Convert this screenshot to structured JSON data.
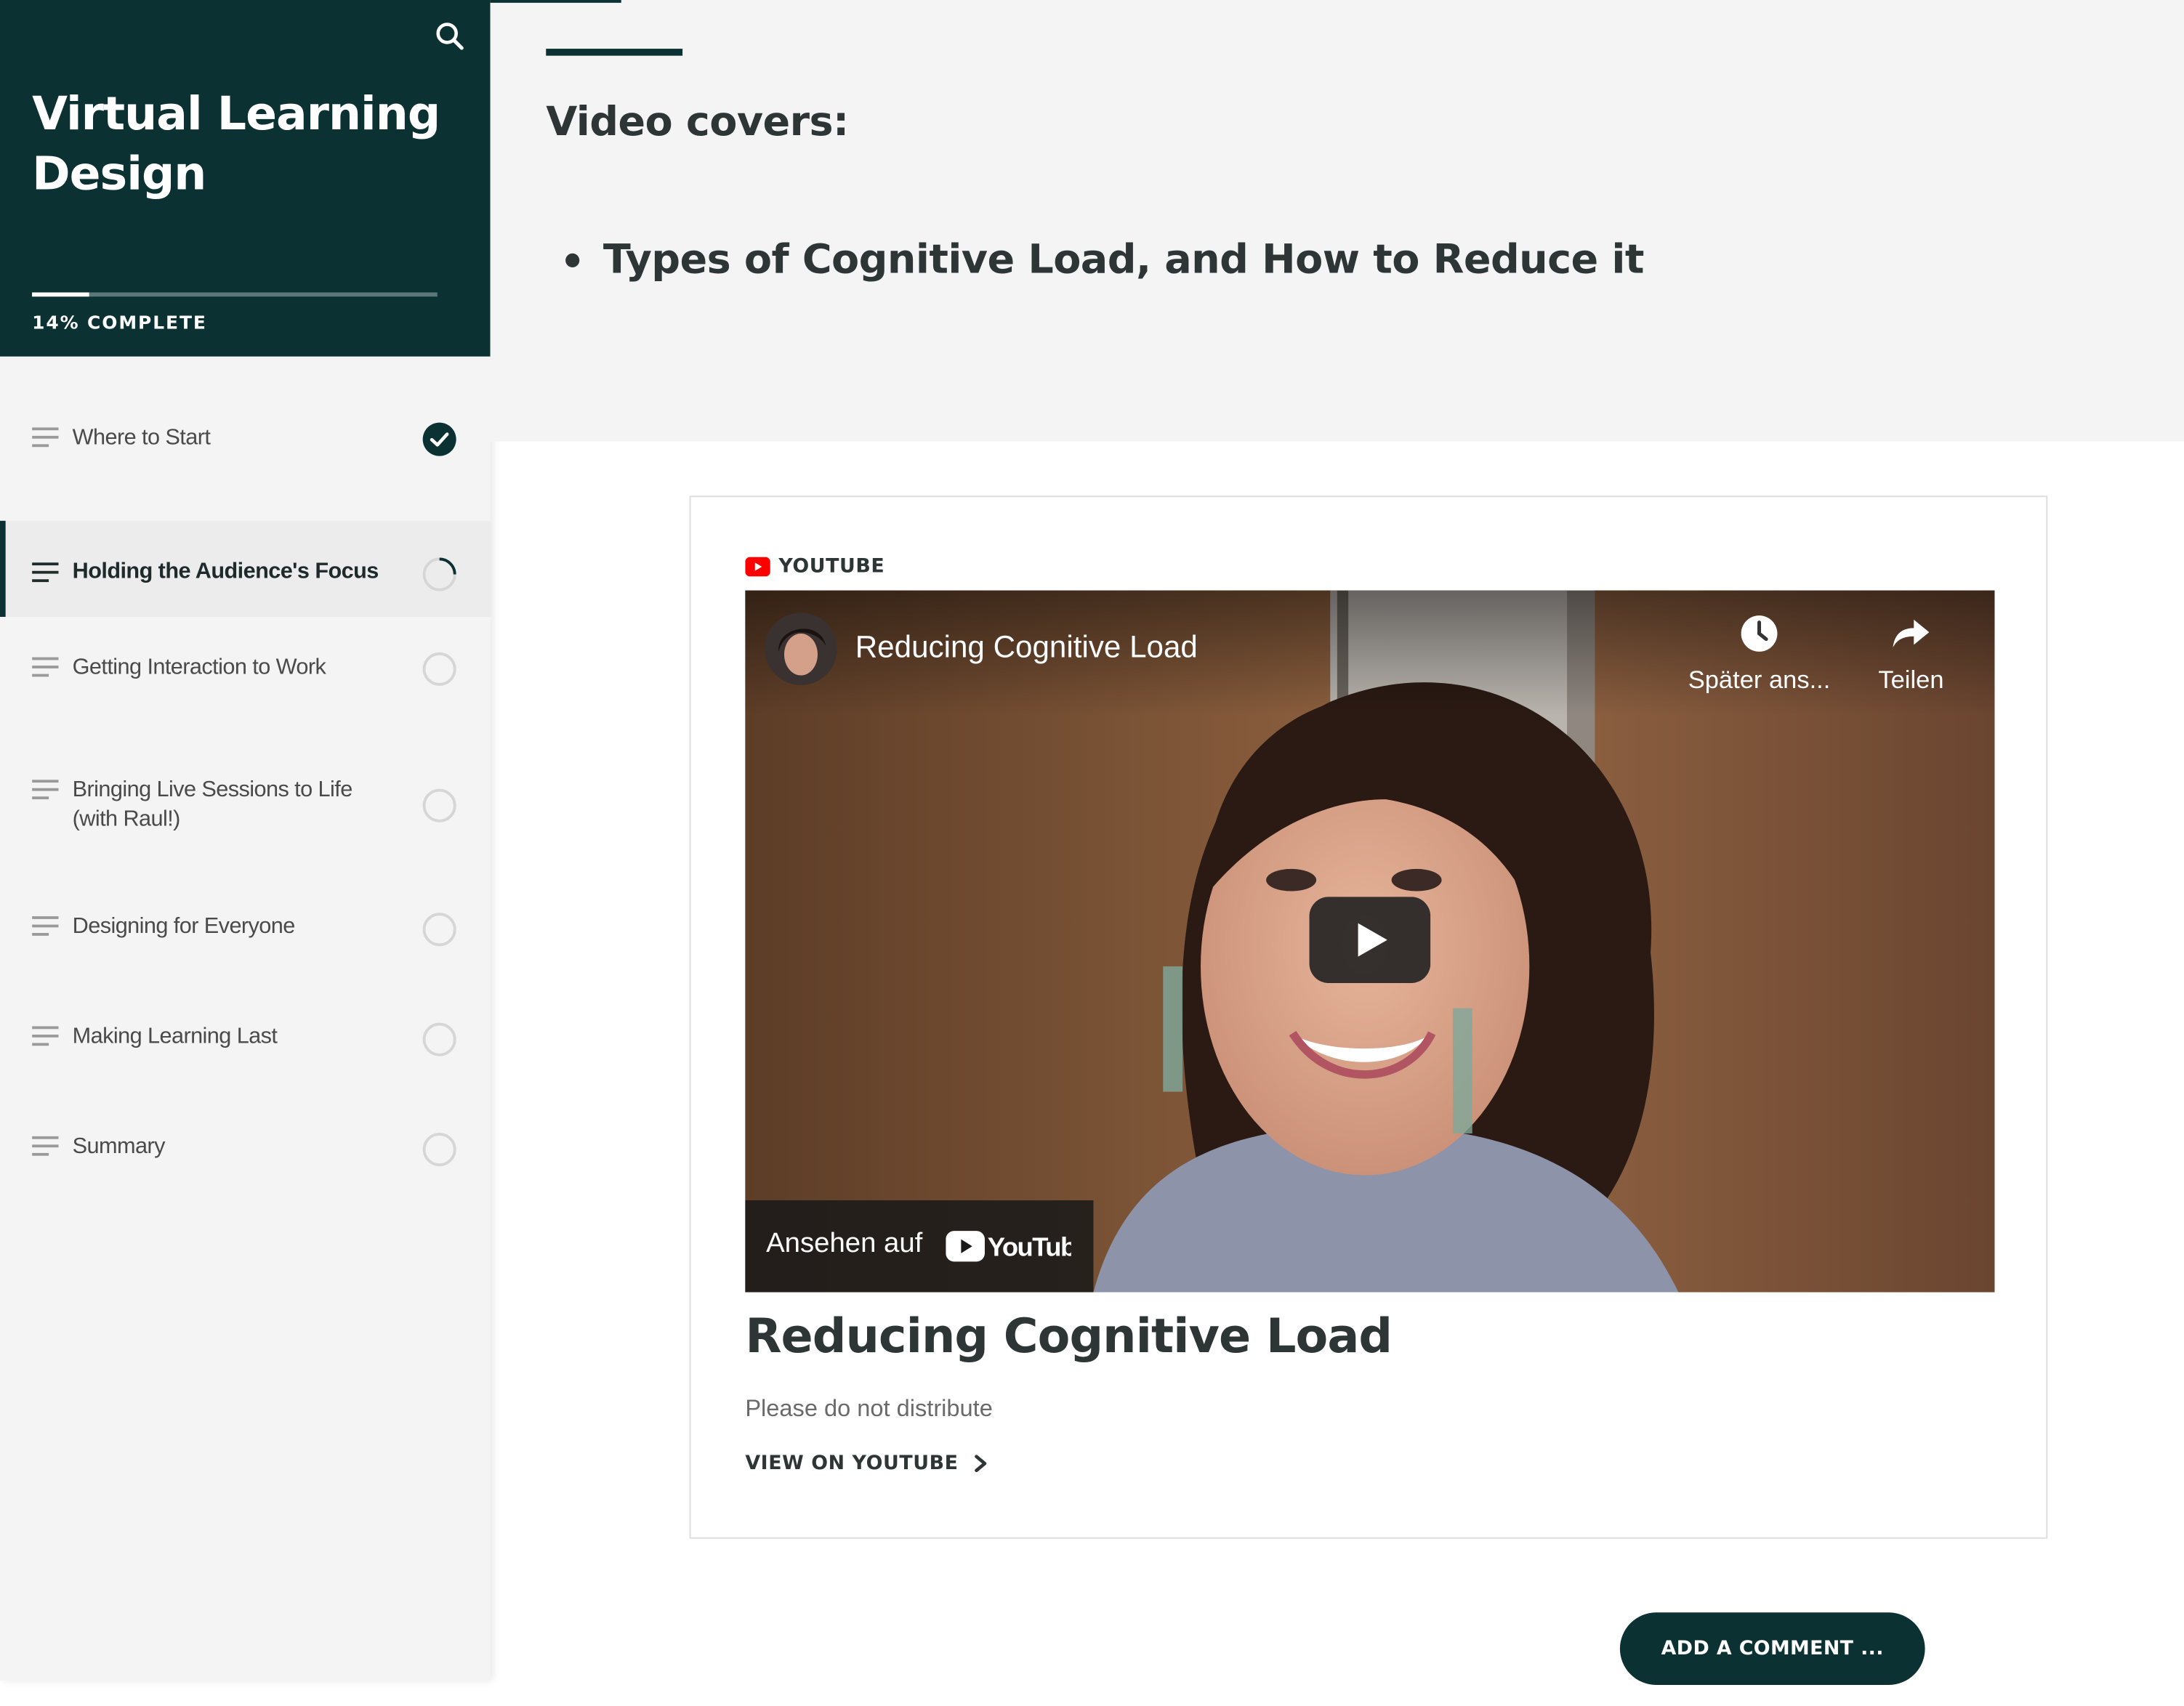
{
  "sidebar": {
    "search_icon": "search-icon",
    "course_title": "Virtual Learning Design",
    "progress": {
      "percent": 14,
      "label": "14% COMPLETE"
    },
    "lessons": [
      {
        "label": "Where to Start",
        "status": "complete"
      },
      {
        "label": "Holding the Audience's Focus",
        "status": "in-progress",
        "active": true
      },
      {
        "label": "Getting Interaction to Work",
        "status": "not-started"
      },
      {
        "label": "Bringing Live Sessions to Life (with Raul!)",
        "status": "not-started"
      },
      {
        "label": "Designing for Everyone",
        "status": "not-started"
      },
      {
        "label": "Making Learning Last",
        "status": "not-started"
      },
      {
        "label": "Summary",
        "status": "not-started"
      }
    ]
  },
  "content": {
    "heading": "Video covers:",
    "bullets": [
      "Types of Cognitive Load, and How to Reduce it"
    ]
  },
  "embed": {
    "provider": "YOUTUBE",
    "video": {
      "title": "Reducing Cognitive Load",
      "watch_later_label": "Später ans...",
      "share_label": "Teilen",
      "watch_on_label": "Ansehen auf",
      "yt_logo_text": "YouTube"
    },
    "title": "Reducing Cognitive Load",
    "description": "Please do not distribute",
    "view_on_label": "VIEW ON YOUTUBE"
  },
  "comment_button_label": "ADD A COMMENT ...",
  "colors": {
    "brand_dark": "#0b3133",
    "youtube_red": "#ff0000",
    "sidebar_bg": "#f4f4f4"
  }
}
